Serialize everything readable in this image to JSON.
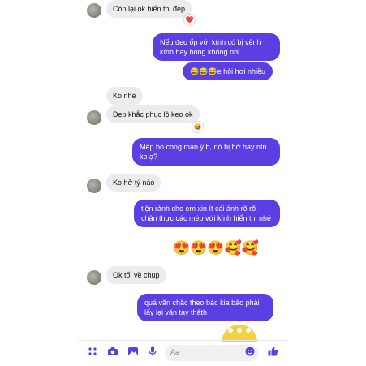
{
  "messages": [
    {
      "from": "them",
      "text": "Còn lại ok hiển thị đẹp"
    },
    {
      "from": "me",
      "text": "Nếu đeo ốp với kính có bị vênh kính hay bong không nhỉ"
    },
    {
      "from": "me",
      "text": "😅😅😅e hỏi hơi nhiều"
    },
    {
      "from": "them",
      "text": "Ko nhé"
    },
    {
      "from": "them",
      "text": "Đẹp khắc phục lộ keo ok"
    },
    {
      "from": "me",
      "text": "Mép bo cong màn ý b, nó bị hở hay ntn ko ạ?"
    },
    {
      "from": "them",
      "text": "Ko hở tý nào"
    },
    {
      "from": "me",
      "text": "tiện rảnh cho em xin ít cái ảnh rõ rõ chân thực các mép với kính hiển thị nhé"
    },
    {
      "from": "me",
      "text": "😍😍😍🥰🥰"
    },
    {
      "from": "them",
      "text": "Ok tối về chụp"
    },
    {
      "from": "me",
      "text": "quá văn chắc theo bác kia bảo phải lấy lại văn tay thâth"
    }
  ],
  "reactions": {
    "heart": "❤️",
    "laugh": "😆"
  },
  "composer": {
    "placeholder": "Aa",
    "icons": [
      "more-icon",
      "camera-icon",
      "image-icon",
      "mic-icon",
      "emoji-icon",
      "like-icon"
    ]
  },
  "colors": {
    "accent": "#5b3fe3",
    "incoming": "#ececee"
  }
}
